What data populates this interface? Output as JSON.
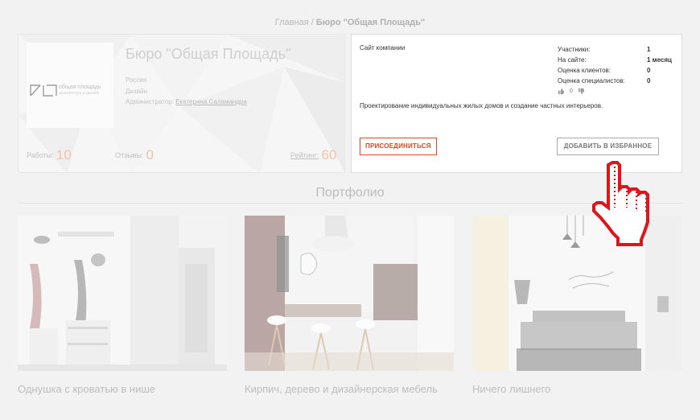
{
  "breadcrumb": {
    "home": "Главная",
    "separator": "/",
    "current": "Бюро \"Общая Площадь\""
  },
  "profile": {
    "name": "Бюро \"Общая Площадь\"",
    "logo_title": "общая площадь",
    "logo_subtitle": "архитектура и дизайн",
    "country": "Россия",
    "category": "Дизайн",
    "admin_label": "Администратор:",
    "admin_name": "Екатерина Саламандра",
    "works_label": "Работы:",
    "works_value": "10",
    "reviews_label": "Отзывы:",
    "reviews_value": "0",
    "rating_label": "Рейтинг:",
    "rating_value": "60"
  },
  "panel": {
    "site_label": "Сайт компании",
    "stats": [
      {
        "label": "Участники:",
        "value": "1"
      },
      {
        "label": "На сайте:",
        "value": "1 месяц"
      },
      {
        "label": "Оценка клиентов:",
        "value": "0"
      },
      {
        "label": "Оценка специалистов:",
        "value": "0"
      }
    ],
    "votes": "0",
    "description": "Проектирование индивидуальных жилых домов и создание частных интерьеров.",
    "join_button": "ПРИСОЕДИНИТЬСЯ",
    "favorite_button": "ДОБАВИТЬ В ИЗБРАННОЕ"
  },
  "portfolio": {
    "title": "Портфолио",
    "items": [
      {
        "caption": "Однушка с кроватью в нише"
      },
      {
        "caption": "Кирпич, дерево и дизайнерская мебель"
      },
      {
        "caption": "Ничего лишнего"
      }
    ]
  },
  "colors": {
    "accent": "#e8461a",
    "stat_number": "#f4c2a8",
    "cursor": "#e0151b"
  },
  "icons": {
    "thumb_up": "thumb-up-icon",
    "thumb_down": "thumb-down-icon",
    "cursor": "hand-pointer-icon"
  }
}
